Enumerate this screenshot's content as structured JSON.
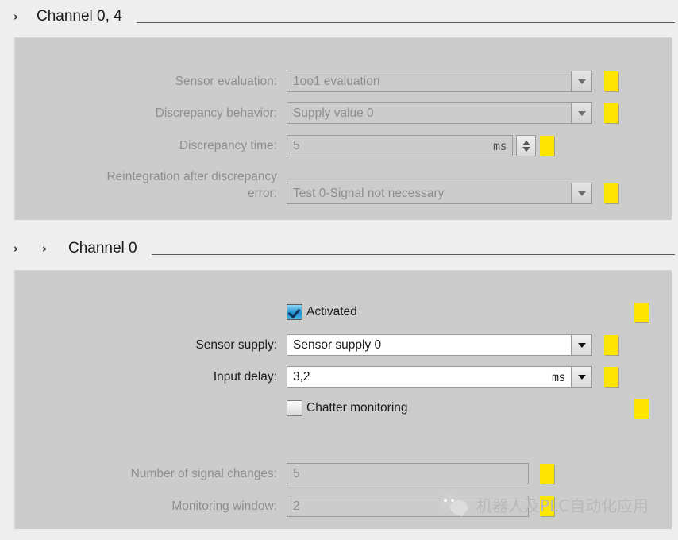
{
  "sections": [
    {
      "expander_icon": "chevron-right-icon",
      "expander_glyph": "›",
      "title": "Channel 0, 4",
      "rows": [
        {
          "label": "Sensor evaluation:",
          "value": "1oo1 evaluation",
          "control": "combo",
          "enabled": false,
          "marker": true
        },
        {
          "label": "Discrepancy behavior:",
          "value": "Supply value 0",
          "control": "combo",
          "enabled": false,
          "marker": true
        },
        {
          "label": "Discrepancy time:",
          "value": "5",
          "unit": "ms",
          "control": "spinbox",
          "enabled": false,
          "marker": true
        },
        {
          "label_line1": "Reintegration after discrepancy",
          "label_line2": "error:",
          "value": "Test 0-Signal not necessary",
          "control": "combo",
          "enabled": false,
          "marker": true
        }
      ]
    },
    {
      "expander_icon": "chevron-right-icon",
      "expander_glyph": "›",
      "expander_glyph_2": "›",
      "title": "Channel 0",
      "rows": [
        {
          "label": "Activated",
          "control": "checkbox",
          "checked": true,
          "enabled": true,
          "marker": true
        },
        {
          "label": "Sensor supply:",
          "value": "Sensor supply 0",
          "control": "combo",
          "enabled": true,
          "marker": true
        },
        {
          "label": "Input delay:",
          "value": "3,2",
          "unit": "ms",
          "control": "combo-unit",
          "enabled": true,
          "marker": true
        },
        {
          "label": "Chatter monitoring",
          "control": "checkbox",
          "checked": false,
          "enabled": true,
          "marker": true
        },
        {
          "label": "Number of signal changes:",
          "value": "5",
          "control": "textbox",
          "enabled": false,
          "marker": true
        },
        {
          "label": "Monitoring window:",
          "value": "2",
          "control": "textbox",
          "enabled": false,
          "marker": true
        }
      ]
    }
  ],
  "watermark": {
    "icon": "wechat-icon",
    "text": "机器人及PLC自动化应用"
  },
  "colors": {
    "marker": "#ffe600",
    "panel": "#cccccc",
    "background": "#eeeeee",
    "label_disabled": "#8e8e8e",
    "label_enabled": "#1a1a1a"
  }
}
